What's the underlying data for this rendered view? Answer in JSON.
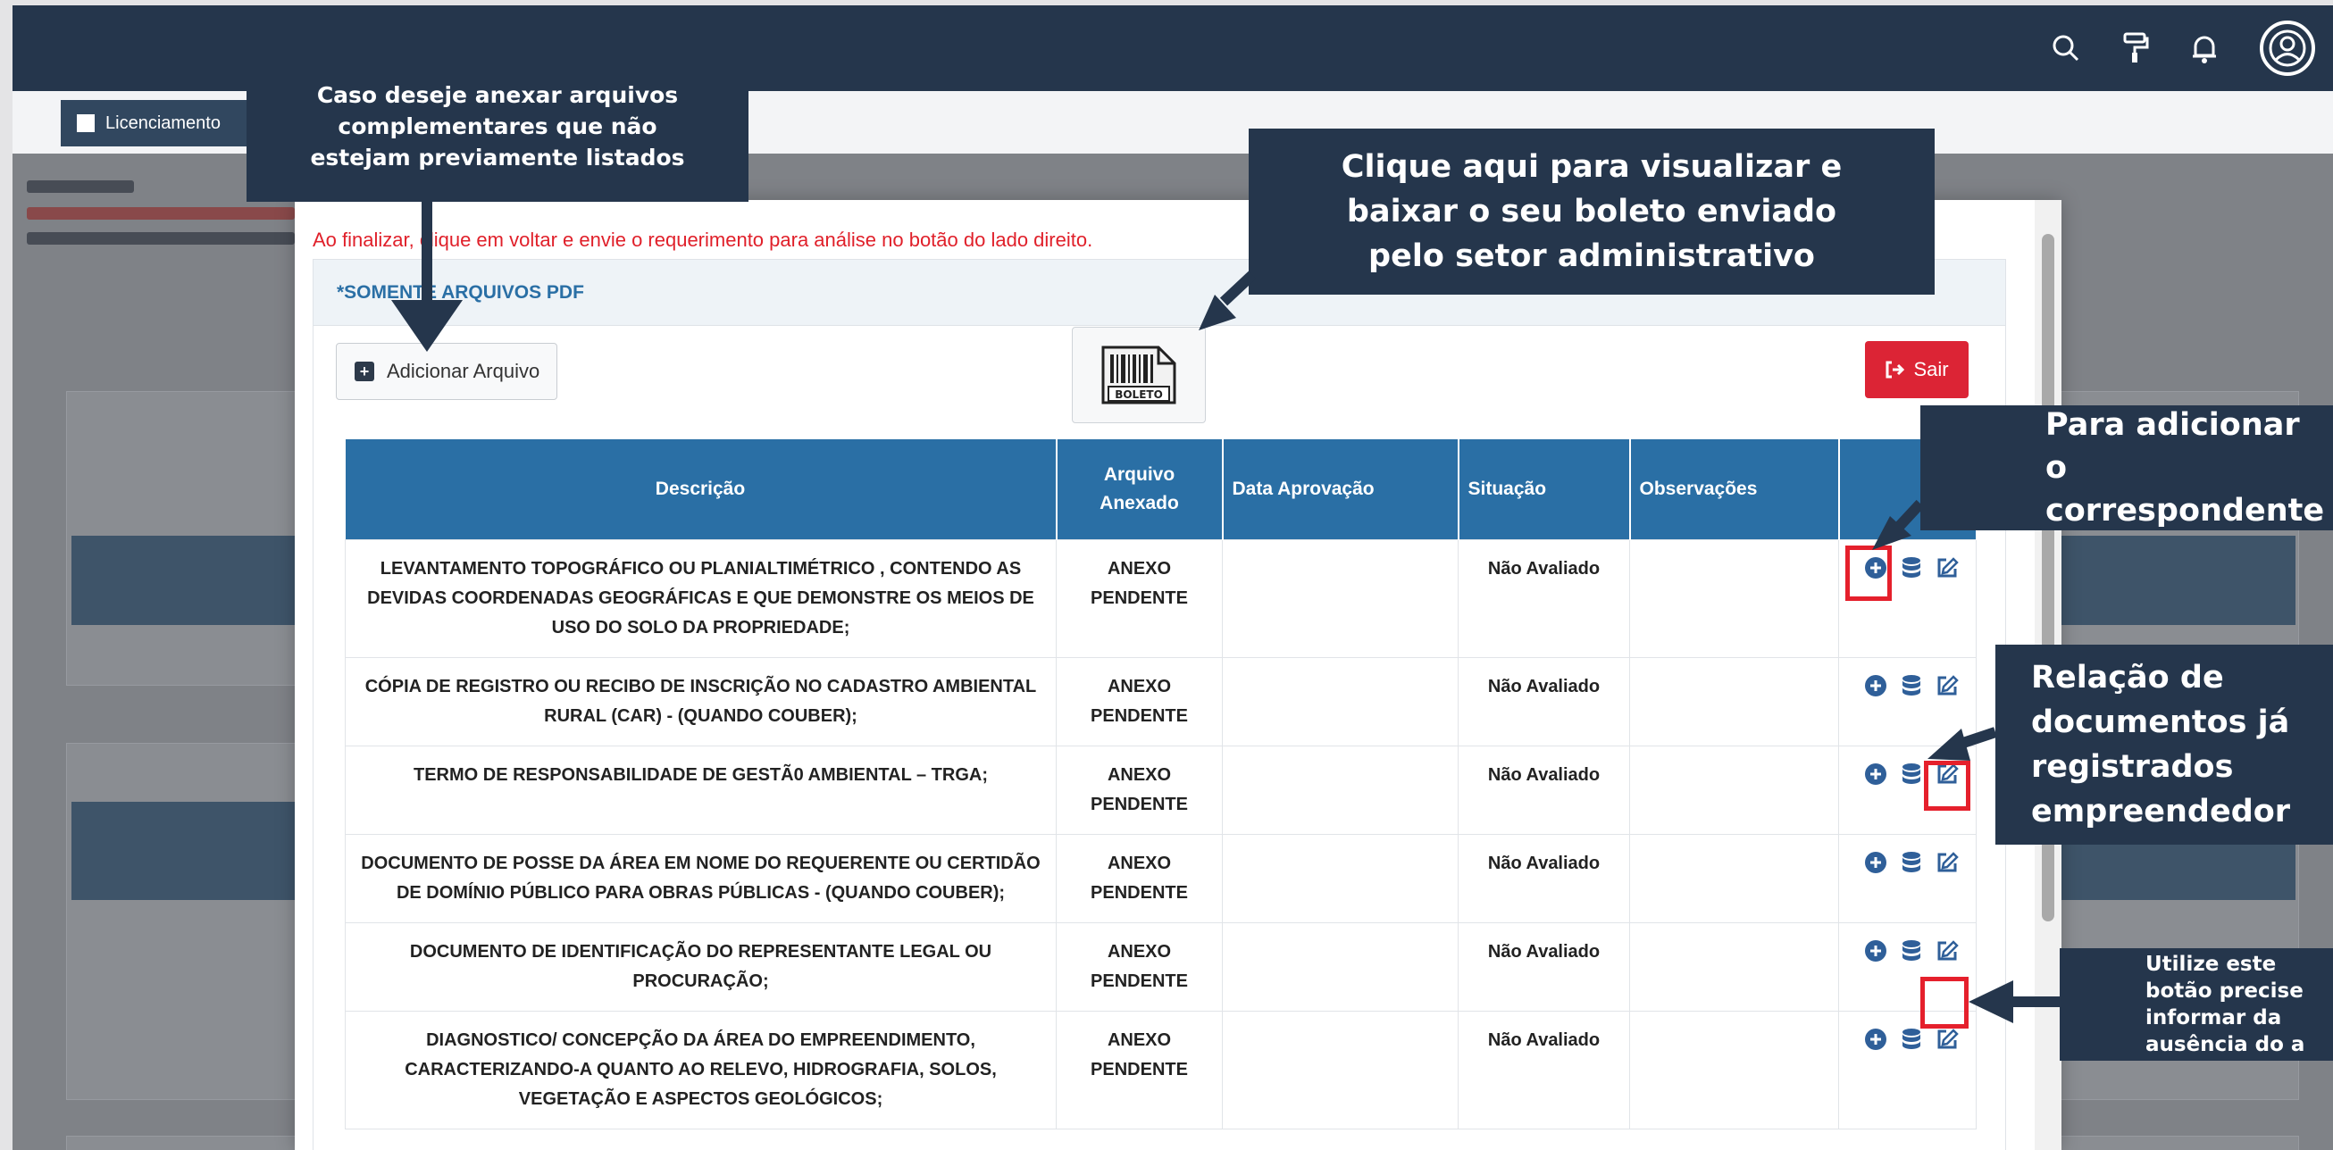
{
  "tab": {
    "label": "Licenciamento"
  },
  "modal": {
    "warning": "Ao finalizar, clique em voltar e envie o requerimento para análise no botão do lado direito.",
    "panel_title": "*SOMENTE ARQUIVOS PDF",
    "add_button": "Adicionar Arquivo",
    "boleto_label": "BOLETO",
    "exit_button": "Sair"
  },
  "table": {
    "headers": [
      "Descrição",
      "Arquivo Anexado",
      "Data Aprovação",
      "Situação",
      "Observações",
      ""
    ],
    "rows": [
      {
        "desc": "LEVANTAMENTO TOPOGRÁFICO OU PLANIALTIMÉTRICO , CONTENDO AS DEVIDAS COORDENADAS GEOGRÁFICAS E QUE DEMONSTRE OS MEIOS DE USO DO SOLO DA PROPRIEDADE;",
        "anexo": "ANEXO PENDENTE",
        "data": "",
        "situacao": "Não Avaliado",
        "obs": ""
      },
      {
        "desc": "CÓPIA DE REGISTRO OU RECIBO DE INSCRIÇÃO NO CADASTRO AMBIENTAL RURAL (CAR) - (QUANDO COUBER);",
        "anexo": "ANEXO PENDENTE",
        "data": "",
        "situacao": "Não Avaliado",
        "obs": ""
      },
      {
        "desc": "TERMO DE RESPONSABILIDADE DE GESTÃ0 AMBIENTAL – TRGA;",
        "anexo": "ANEXO PENDENTE",
        "data": "",
        "situacao": "Não Avaliado",
        "obs": ""
      },
      {
        "desc": "DOCUMENTO DE POSSE DA ÁREA EM NOME DO REQUERENTE OU CERTIDÃO DE DOMÍNIO PÚBLICO PARA OBRAS PÚBLICAS - (QUANDO COUBER);",
        "anexo": "ANEXO PENDENTE",
        "data": "",
        "situacao": "Não Avaliado",
        "obs": ""
      },
      {
        "desc": "DOCUMENTO DE IDENTIFICAÇÃO DO REPRESENTANTE LEGAL OU PROCURAÇÃO;",
        "anexo": "ANEXO PENDENTE",
        "data": "",
        "situacao": "Não Avaliado",
        "obs": ""
      },
      {
        "desc": "DIAGNOSTICO/ CONCEPÇÃO DA ÁREA DO EMPREENDIMENTO, CARACTERIZANDO-A QUANTO AO RELEVO, HIDROGRAFIA, SOLOS, VEGETAÇÃO E ASPECTOS GEOLÓGICOS;",
        "anexo": "ANEXO PENDENTE",
        "data": "",
        "situacao": "Não Avaliado",
        "obs": ""
      }
    ]
  },
  "callouts": {
    "add_file": "Caso deseje anexar arquivos complementares que não estejam previamente listados",
    "boleto": "Clique aqui para visualizar e baixar o seu boleto enviado pelo setor administrativo",
    "add_doc": "Para adicionar o correspondente",
    "relation": "Relação de documentos já registrados empreendedor",
    "edit": "Utilize este botão precise informar da ausência do a"
  },
  "icons": [
    "search-icon",
    "paint-roller-icon",
    "bell-icon",
    "user-avatar-icon",
    "plus-circle-icon",
    "database-icon",
    "edit-icon",
    "exit-icon",
    "barcode-icon"
  ],
  "colors": {
    "navbar": "#25364c",
    "table_header": "#2a6fa5",
    "pending": "#e0202a",
    "exit": "#dc2435",
    "highlight": "#e5202c"
  }
}
